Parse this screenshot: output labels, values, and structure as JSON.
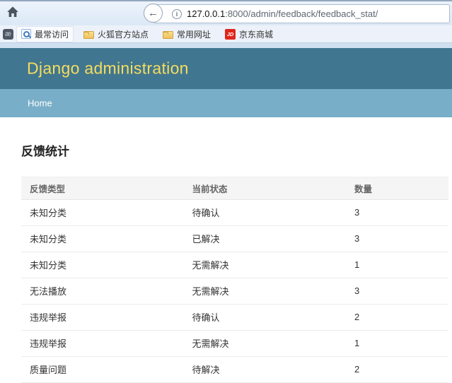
{
  "browser": {
    "url_host": "127.0.0.1",
    "url_path": ":8000/admin/feedback/feedback_stat/",
    "favicon_glyph": "æ",
    "info_glyph": "i",
    "back_glyph": "←",
    "bookmarks": [
      {
        "label": "最常访问",
        "icon": "most-visited"
      },
      {
        "label": "火狐官方站点",
        "icon": "folder"
      },
      {
        "label": "常用网址",
        "icon": "folder"
      },
      {
        "label": "京东商城",
        "icon": "jd",
        "badge": "JD"
      }
    ]
  },
  "header": {
    "title": "Django administration"
  },
  "breadcrumb": {
    "home": "Home"
  },
  "page": {
    "title": "反馈统计"
  },
  "table": {
    "columns": [
      "反馈类型",
      "当前状态",
      "数量"
    ],
    "rows": [
      [
        "未知分类",
        "待确认",
        3
      ],
      [
        "未知分类",
        "已解决",
        3
      ],
      [
        "未知分类",
        "无需解决",
        1
      ],
      [
        "无法播放",
        "无需解决",
        3
      ],
      [
        "违规举报",
        "待确认",
        2
      ],
      [
        "违规举报",
        "无需解决",
        1
      ],
      [
        "质量问题",
        "待解决",
        2
      ]
    ]
  },
  "colors": {
    "header_bg": "#417690",
    "breadcrumb_bg": "#79aec8",
    "title_yellow": "#f5dd5d",
    "jd_red": "#e1251b"
  }
}
